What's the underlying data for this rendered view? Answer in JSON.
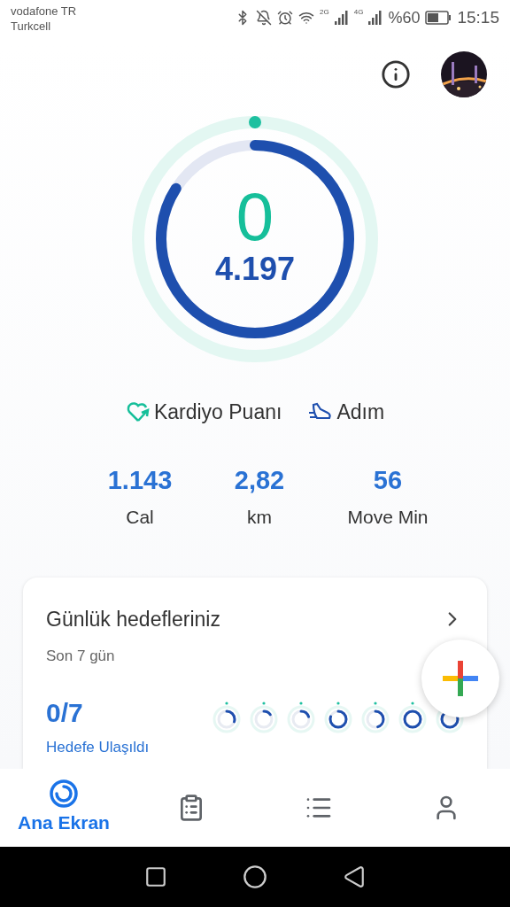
{
  "status_bar": {
    "carriers": [
      "vodafone TR",
      "Turkcell"
    ],
    "net_2g": "2G",
    "net_4g": "4G",
    "battery": "%60",
    "time": "15:15"
  },
  "ring": {
    "heart_value": "0",
    "steps_value": "4.197"
  },
  "legend": [
    {
      "kind": "heart",
      "label": "Kardiyo Puanı"
    },
    {
      "kind": "steps",
      "label": "Adım"
    }
  ],
  "stats": [
    {
      "value": "1.143",
      "label": "Cal"
    },
    {
      "value": "2,82",
      "label": "km"
    },
    {
      "value": "56",
      "label": "Move Min"
    }
  ],
  "goals_card": {
    "title": "Günlük hedefleriniz",
    "subtitle": "Son 7 gün",
    "count": "0/7",
    "caption": "Hedefe Ulaşıldı"
  },
  "nav": [
    {
      "kind": "home",
      "label": "Ana Ekran",
      "selected": true
    },
    {
      "kind": "journal",
      "selected": false
    },
    {
      "kind": "browse",
      "selected": false
    },
    {
      "kind": "profile",
      "selected": false
    }
  ]
}
